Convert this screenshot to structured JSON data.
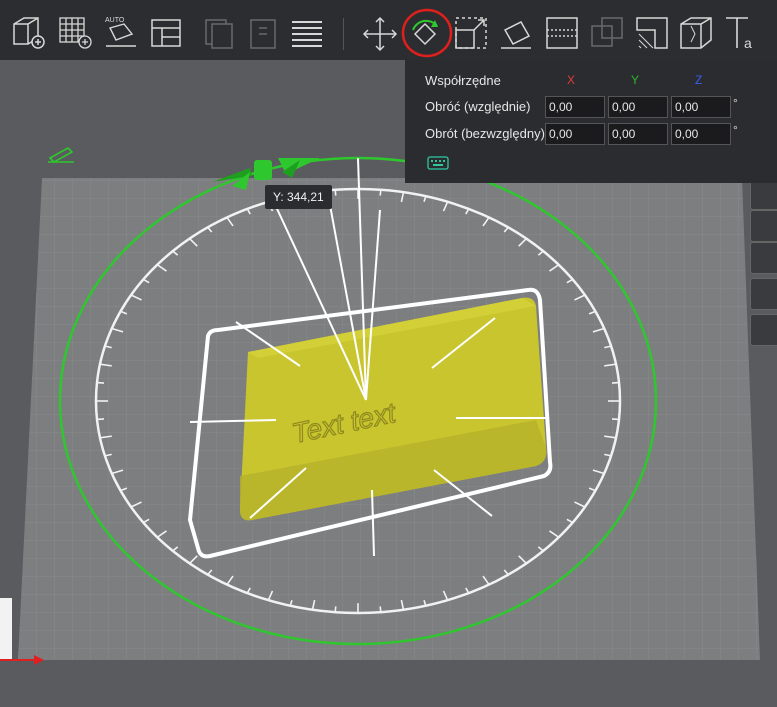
{
  "toolbar": {
    "buttons": [
      {
        "name": "add-object-icon"
      },
      {
        "name": "add-grid-icon"
      },
      {
        "name": "auto-arrange-icon",
        "label": "AUTO"
      },
      {
        "name": "layout-icon"
      },
      {
        "name": "copy-icon"
      },
      {
        "name": "paste-icon"
      },
      {
        "name": "list-icon"
      },
      {
        "name": "move-icon"
      },
      {
        "name": "rotate-icon",
        "active": true,
        "highlight_color": "#e0201c"
      },
      {
        "name": "scale-icon"
      },
      {
        "name": "place-on-face-icon"
      },
      {
        "name": "cut-icon"
      },
      {
        "name": "boolean-icon"
      },
      {
        "name": "support-paint-icon"
      },
      {
        "name": "seam-paint-icon"
      },
      {
        "name": "text-icon"
      }
    ]
  },
  "panel": {
    "header": "Współrzędne",
    "axes": {
      "x": "X",
      "y": "Y",
      "z": "Z"
    },
    "axis_colors": {
      "x": "#e03a3a",
      "y": "#2db52d",
      "z": "#3a5ef0"
    },
    "rows": [
      {
        "label": "Obróć (względnie)",
        "x": "0,00",
        "y": "0,00",
        "z": "0,00",
        "unit": "°"
      },
      {
        "label": "Obrót (bezwzględny)",
        "x": "0,00",
        "y": "0,00",
        "z": "0,00",
        "unit": "°"
      }
    ],
    "keyboard_icon": "keyboard-icon"
  },
  "tooltip": {
    "text": "Y: 344,21"
  },
  "viewport": {
    "object_text": "Text text",
    "object_color": "#c9c52f",
    "ring_color": "#2ec82e",
    "plate_color": "#7d7e80"
  }
}
